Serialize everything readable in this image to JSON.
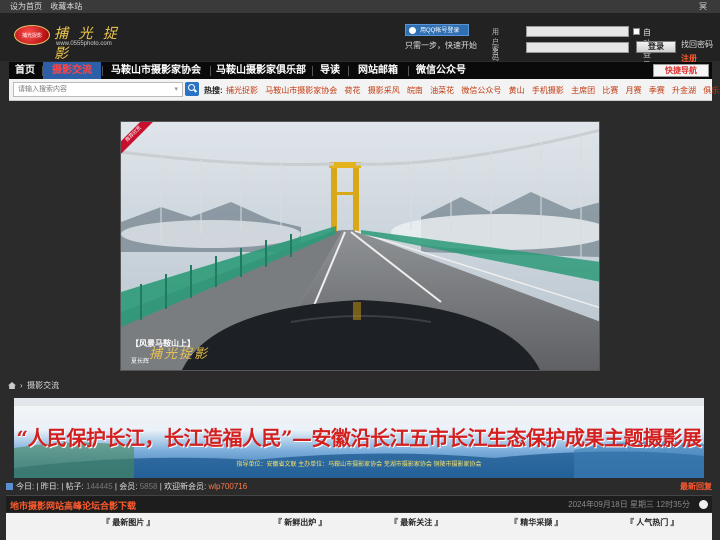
{
  "topbar": {
    "set_home": "设为首页",
    "bookmark": "收藏本站",
    "right_label": "冥"
  },
  "logo": {
    "mark_text": "捕光捉影",
    "name": "捕 光 捉 影",
    "url": "www.0555photo.com"
  },
  "qq_login": {
    "button_label": "用QQ帐号登录",
    "tip": "只需一步，快速开始"
  },
  "login": {
    "username_label": "用户名",
    "password_label": "密码",
    "auto_login_label": "自动登录",
    "login_button": "登录",
    "forgot_password": "找回密码",
    "register": "注册"
  },
  "nav": {
    "items": [
      "首页",
      "摄影交流",
      "马鞍山市摄影家协会",
      "马鞍山摄影家俱乐部",
      "导读",
      "网站邮箱",
      "微信公众号"
    ],
    "active_index": 1,
    "quick_nav": "快捷导航"
  },
  "search": {
    "placeholder": "请输入搜索内容",
    "hot_label": "热搜:",
    "hot_links": [
      "捕光捉影",
      "马鞍山市摄影家协会",
      "荷花",
      "摄影采风",
      "皖南",
      "油菜花",
      "微信公众号",
      "黄山",
      "手机摄影",
      "主席团",
      "比赛",
      "月赛",
      "季赛",
      "升金湖",
      "俱乐部"
    ]
  },
  "featured_photo": {
    "ribbon": "推荐欣赏",
    "caption": "【风景马鞍山上】",
    "author": "夏长辉",
    "watermark": "捕光捉影"
  },
  "breadcrumb": {
    "label": "摄影交流"
  },
  "banner": {
    "title": "“人民保护长江，长江造福人民”—安徽沿长江五市长江生态保护成果主题摄影展",
    "subtitle": "指导单位：安徽省文联  主办单位：马鞍山市摄影家协会 芜湖市摄影家协会 铜陵市摄影家协会"
  },
  "stats": {
    "today_label": "今日:",
    "yesterday_label": "昨日:",
    "posts_label": "帖子:",
    "posts_value": "144445",
    "members_label": "会员:",
    "members_value": "5858",
    "welcome_label": "欢迎新会员:",
    "new_member": "wlp700716",
    "new_replies": "最新回复"
  },
  "section": {
    "title": "地市摄影网站高峰论坛合影下载",
    "date": "2024年09月18日 星期三 12时35分"
  },
  "tabs": [
    "『 最新图片 』",
    "『 新鲜出炉 』",
    "『 最新关注 』",
    "『 精华采撷 』",
    "『 人气热门 』"
  ],
  "colors": {
    "accent_orange": "#ff5a2e",
    "nav_active_bg": "#2d5fa8",
    "banner_red": "#d41f1f",
    "qq_blue": "#2f6fb3"
  }
}
